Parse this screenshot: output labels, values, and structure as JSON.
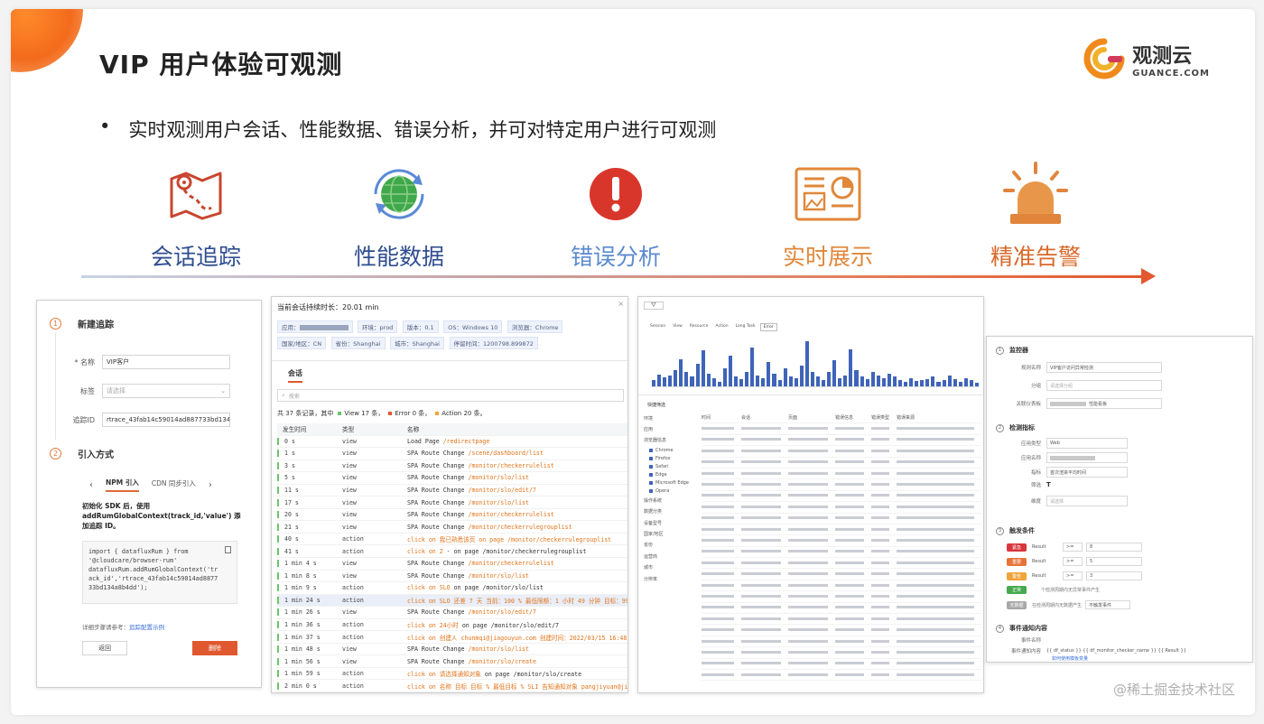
{
  "slide": {
    "title": "VIP 用户体验可观测",
    "bullet_symbol": "•",
    "bullet": "实时观测用户会话、性能数据、错误分析，并可对特定用户进行可观测",
    "watermark": "@稀土掘金技术社区",
    "logo": {
      "cn": "观测云",
      "en": "GUANCE.COM",
      "icon": "guance-logo-icon"
    }
  },
  "features": [
    {
      "label": "会话追踪",
      "icon": "map-route-icon",
      "color": "#2f4d8f"
    },
    {
      "label": "性能数据",
      "icon": "globe-refresh-icon",
      "color": "#2f4d8f"
    },
    {
      "label": "错误分析",
      "icon": "error-alert-icon",
      "color": "#5b8ad0"
    },
    {
      "label": "实时展示",
      "icon": "dashboard-screen-icon",
      "color": "#e0873a"
    },
    {
      "label": "精准告警",
      "icon": "alarm-light-icon",
      "color": "#d9682a"
    }
  ],
  "panel_tracking": {
    "step1": {
      "num": "1",
      "title": "新建追踪"
    },
    "name_label": "* 名称",
    "name_value": "VIP客户",
    "tag_label": "标签",
    "tag_placeholder": "请选择",
    "trace_label": "追踪ID",
    "trace_value": "rtrace_43fab14c59014ad887733bd134a",
    "step2": {
      "num": "2",
      "title": "引入方式"
    },
    "tab_prev": "‹",
    "tab_npm": "NPM 引入",
    "tab_cdn": "CDN 同步引入",
    "tab_next": "›",
    "desc_line1": "初始化 SDK 后，使用",
    "desc_line2": "addRumGlobalContext(track_id,'value') 添",
    "desc_line3": "加追踪 ID。",
    "code": [
      "import { datafluxRum } from",
      "  '@cloudcare/browser-rum'",
      "datafluxRum.addRumGlobalContext('tr",
      "ack_id','rtrace_43fab14c59014ad8877",
      "33bd134a8b4dd');"
    ],
    "help_text": "详细步骤请参考：",
    "help_link": "追踪配置示例",
    "back_btn": "返回",
    "delete_btn": "删除"
  },
  "panel_session": {
    "duration_label": "当前会话持续时长：20.01 min",
    "tags": [
      "应用：",
      "环境：prod",
      "版本：0.1",
      "OS：Windows 10",
      "浏览器：Chrome",
      "国家/地区：CN",
      "省份：Shanghai",
      "城市：Shanghai",
      "停留时间：1200798.899872"
    ],
    "tab": "会话",
    "search_placeholder": "搜索",
    "summary": "共 37 条记录，其中",
    "summary_view": "View 17 条，",
    "summary_error": "Error 0 条，",
    "summary_action": "Action 20 条。",
    "headers": [
      "发生时间",
      "类型",
      "名称"
    ],
    "rows": [
      {
        "t": "0 s",
        "type": "view",
        "pre": "Load Page ",
        "hl": "/redirectpage",
        "post": ""
      },
      {
        "t": "1 s",
        "type": "view",
        "pre": "SPA Route Change ",
        "hl": "/scene/dashboard/list",
        "post": ""
      },
      {
        "t": "3 s",
        "type": "view",
        "pre": "SPA Route Change ",
        "hl": "/monitor/checkerrulelist",
        "post": ""
      },
      {
        "t": "5 s",
        "type": "view",
        "pre": "SPA Route Change ",
        "hl": "/monitor/slo/list",
        "post": ""
      },
      {
        "t": "11 s",
        "type": "view",
        "pre": "SPA Route Change ",
        "hl": "/monitor/slo/edit/7",
        "post": ""
      },
      {
        "t": "17 s",
        "type": "view",
        "pre": "SPA Route Change ",
        "hl": "/monitor/slo/list",
        "post": ""
      },
      {
        "t": "20 s",
        "type": "view",
        "pre": "SPA Route Change ",
        "hl": "/monitor/checkerrulelist",
        "post": ""
      },
      {
        "t": "21 s",
        "type": "view",
        "pre": "SPA Route Change ",
        "hl": "/monitor/checkerrulegrouplist",
        "post": ""
      },
      {
        "t": "40 s",
        "type": "action",
        "pre": "",
        "hl": "click on 我已熟悉该页 on page /monitor/checkerrulegrouplist",
        "post": ""
      },
      {
        "t": "41 s",
        "type": "action",
        "pre": "",
        "hl": "click on 2 ",
        "post": "- on page /monitor/checkerrulegrouplist"
      },
      {
        "t": "1 min 4 s",
        "type": "view",
        "pre": "SPA Route Change ",
        "hl": "/monitor/checkerrulelist",
        "post": ""
      },
      {
        "t": "1 min 8 s",
        "type": "view",
        "pre": "SPA Route Change ",
        "hl": "/monitor/slo/list",
        "post": ""
      },
      {
        "t": "1 min 9 s",
        "type": "action",
        "pre": "",
        "hl": "click on SLO ",
        "post": "on page /monitor/slo/list"
      },
      {
        "t": "1 min 24 s",
        "type": "action",
        "pre": "",
        "hl": "click on SLO 还差 7 天 当前：100 % 最低限额：1 小时 49 分钟 目标：99 % 至年 SLA...",
        "post": ""
      },
      {
        "t": "1 min 26 s",
        "type": "view",
        "pre": "SPA Route Change ",
        "hl": "/monitor/slo/edit/7",
        "post": ""
      },
      {
        "t": "1 min 36 s",
        "type": "action",
        "pre": "",
        "hl": "click on 24小时 ",
        "post": "on page /monitor/slo/edit/7"
      },
      {
        "t": "1 min 37 s",
        "type": "action",
        "pre": "",
        "hl": "click on 创建人 chunmqi@jiagouyun.com 创建时间：2022/03/15 16:48:19 最后更新...",
        "post": ""
      },
      {
        "t": "1 min 48 s",
        "type": "view",
        "pre": "SPA Route Change ",
        "hl": "/monitor/slo/list",
        "post": ""
      },
      {
        "t": "1 min 56 s",
        "type": "view",
        "pre": "SPA Route Change ",
        "hl": "/monitor/slo/create",
        "post": ""
      },
      {
        "t": "1 min 59 s",
        "type": "action",
        "pre": "",
        "hl": "click on 请选择通知对象 ",
        "post": "on page /monitor/slo/create"
      },
      {
        "t": "2 min 0 s",
        "type": "action",
        "pre": "",
        "hl": "click on 名称 目标 目标 % 最低目标 % SLI 告知通知对象 pangjiyuan@jiagouyun.com...",
        "post": ""
      }
    ]
  },
  "panel_explorer": {
    "tabs": [
      "Session",
      "View",
      "Resource",
      "Action",
      "Long Task",
      "Error"
    ],
    "active_tab": "Error",
    "filter_title": "快捷筛选",
    "filter_items": [
      "环境",
      "应用",
      "浏览器信息",
      "操作系统",
      "数据分类",
      "设备型号",
      "国家/地区",
      "省份",
      "运营商",
      "城市",
      "分辨率"
    ],
    "filter_checks": [
      "Chrome",
      "Firefox",
      "Safari",
      "Edge",
      "Microsoft Edge",
      "Opera"
    ],
    "list_headers": [
      "时间",
      "会话",
      "页面",
      "错误信息",
      "错误类型",
      "错误来源"
    ],
    "chart_bars": [
      8,
      15,
      11,
      14,
      20,
      34,
      18,
      12,
      28,
      45,
      16,
      10,
      6,
      22,
      38,
      12,
      9,
      18,
      48,
      14,
      10,
      30,
      16,
      8,
      22,
      12,
      10,
      26,
      56,
      18,
      12,
      8,
      18,
      32,
      10,
      14,
      46,
      20,
      12,
      9,
      18,
      14,
      10,
      16,
      12,
      8,
      6,
      10,
      7,
      8,
      9,
      12,
      6,
      8,
      14,
      9,
      6,
      10,
      8,
      5
    ]
  },
  "panel_monitor": {
    "sec1": {
      "num": "1",
      "title": "监控器"
    },
    "rule_name_label": "规则名称",
    "rule_name_value": "VIP客户访问异常检测",
    "group_label": "分组",
    "group_placeholder": "请选择分组",
    "dashboard_label": "关联仪表板",
    "dashboard_value": "性能看板",
    "sec2": {
      "num": "2",
      "title": "检测指标"
    },
    "app_type_label": "应用类型",
    "app_type_value": "Web",
    "app_name_label": "应用名称",
    "metric_label": "指标",
    "metric_value": "首次渲染平均时间",
    "filter_label": "筛选",
    "filter_value": "T",
    "dim_label": "维度",
    "dim_placeholder": "请选择",
    "sec3": {
      "num": "3",
      "title": "触发条件"
    },
    "levels": [
      {
        "name": "紧急",
        "color": "#d9363e",
        "op": ">=",
        "val": "8"
      },
      {
        "name": "重要",
        "color": "#e8733a",
        "op": ">=",
        "val": "5"
      },
      {
        "name": "警告",
        "color": "#f0a33a",
        "op": ">=",
        "val": "3"
      },
      {
        "name": "正常",
        "color": "#46a94f",
        "op": "",
        "val": ""
      },
      {
        "name": "无数据",
        "color": "#a8a8a8",
        "op": "",
        "val": ""
      }
    ],
    "result_label": "Result",
    "normal_text": "个检测周期内无异常事件产生",
    "nodata_text": "在检测周期内无数据产生",
    "nodata_select": "不触发事件",
    "sec4": {
      "num": "4",
      "title": "事件通知内容"
    },
    "event_name_label": "事件名称",
    "event_content_label": "事件通知内容",
    "template_vars": "{{ df_status }}   {{ df_monitor_checker_name }}   {{ Result }}",
    "template_link": "如何使用模板变量"
  }
}
